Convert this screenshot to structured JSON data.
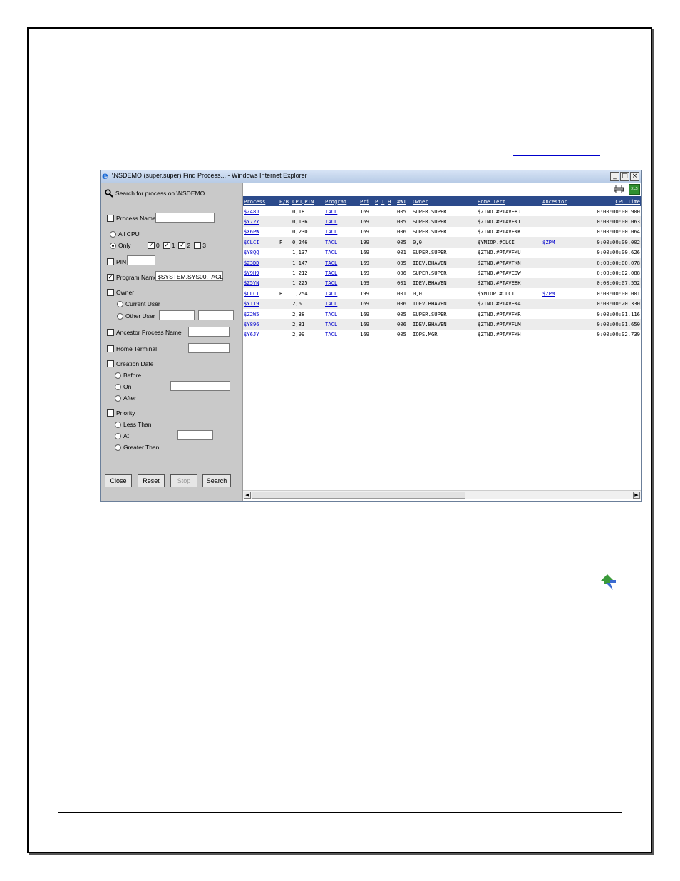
{
  "window": {
    "title": "\\NSDEMO (super.super) Find Process... - Windows Internet Explorer",
    "minimize": "_",
    "maximize": "□",
    "close": "×"
  },
  "search_panel": {
    "heading": "Search for process on \\NSDEMO",
    "process_name": {
      "label": "Process Name",
      "checked": false,
      "value": ""
    },
    "cpu": {
      "all_label": "All CPU",
      "only_label": "Only",
      "selected": "Only",
      "cpus": [
        {
          "label": "0",
          "checked": true
        },
        {
          "label": "1",
          "checked": true
        },
        {
          "label": "2",
          "checked": true
        },
        {
          "label": "3",
          "checked": false
        }
      ]
    },
    "pin": {
      "label": "PIN",
      "checked": false,
      "value": ""
    },
    "program_name": {
      "label": "Program Name",
      "checked": true,
      "value": "$SYSTEM.SYS00.TACL"
    },
    "owner": {
      "label": "Owner",
      "checked": false,
      "current_user_label": "Current User",
      "other_user_label": "Other User"
    },
    "ancestor": {
      "label": "Ancestor Process Name",
      "checked": false,
      "value": ""
    },
    "home_terminal": {
      "label": "Home Terminal",
      "checked": false,
      "value": ""
    },
    "creation_date": {
      "label": "Creation Date",
      "checked": false,
      "before_label": "Before",
      "on_label": "On",
      "after_label": "After",
      "value": ""
    },
    "priority": {
      "label": "Priority",
      "checked": false,
      "less_label": "Less Than",
      "at_label": "At",
      "greater_label": "Greater Than",
      "value": ""
    },
    "buttons": {
      "close": "Close",
      "reset": "Reset",
      "stop": "Stop",
      "search": "Search"
    }
  },
  "results": {
    "columns": [
      "Process",
      "P/B",
      "CPU,PIN",
      "Program",
      "Pri",
      "P",
      "I",
      "H",
      "#WI",
      "Owner",
      "Home Term",
      "Ancestor",
      "CPU Time"
    ],
    "rows": [
      [
        "$Z48J",
        "",
        "0,18",
        "TACL",
        "169",
        "",
        "",
        "",
        "005",
        "SUPER.SUPER",
        "$ZTNO.#PTAVE8J",
        "",
        "0:00:00:00.900"
      ],
      [
        "$Y72Y",
        "",
        "0,136",
        "TACL",
        "169",
        "",
        "",
        "",
        "005",
        "SUPER.SUPER",
        "$ZTNO.#PTAVFKT",
        "",
        "0:00:00:00.063"
      ],
      [
        "$X6PW",
        "",
        "0,230",
        "TACL",
        "169",
        "",
        "",
        "",
        "006",
        "SUPER.SUPER",
        "$ZTNO.#PTAVFKK",
        "",
        "0:00:00:00.064"
      ],
      [
        "$CLCI",
        "P",
        "0,246",
        "TACL",
        "199",
        "",
        "",
        "",
        "005",
        "0,0",
        "$YMIOP.#CLCI",
        "$ZPM",
        "0:00:00:00.002"
      ],
      [
        "$Y8QQ",
        "",
        "1,137",
        "TACL",
        "169",
        "",
        "",
        "",
        "001",
        "SUPER.SUPER",
        "$ZTNO.#PTAVFKU",
        "",
        "0:00:00:00.626"
      ],
      [
        "$Z3DD",
        "",
        "1,147",
        "TACL",
        "169",
        "",
        "",
        "",
        "005",
        "IDEV.BHAVEN",
        "$ZTNO.#PTAVFKN",
        "",
        "0:00:00:00.078"
      ],
      [
        "$Y9H9",
        "",
        "1,212",
        "TACL",
        "169",
        "",
        "",
        "",
        "006",
        "SUPER.SUPER",
        "$ZTNO.#PTAVE9W",
        "",
        "0:00:00:02.088"
      ],
      [
        "$Z5YN",
        "",
        "1,225",
        "TACL",
        "169",
        "",
        "",
        "",
        "001",
        "IDEV.BHAVEN",
        "$ZTNO.#PTAVE8K",
        "",
        "0:00:00:07.552"
      ],
      [
        "$CLCI",
        "B",
        "1,254",
        "TACL",
        "199",
        "",
        "",
        "",
        "001",
        "0,0",
        "$YMIOP.#CLCI",
        "$ZPM",
        "0:00:00:00.001"
      ],
      [
        "$Y119",
        "",
        "2,6",
        "TACL",
        "169",
        "",
        "",
        "",
        "006",
        "IDEV.BHAVEN",
        "$ZTNO.#PTAVEK4",
        "",
        "0:00:00:20.330"
      ],
      [
        "$Z2W5",
        "",
        "2,38",
        "TACL",
        "169",
        "",
        "",
        "",
        "005",
        "SUPER.SUPER",
        "$ZTNO.#PTAVFKR",
        "",
        "0:00:00:01.116"
      ],
      [
        "$Y896",
        "",
        "2,81",
        "TACL",
        "169",
        "",
        "",
        "",
        "006",
        "IDEV.BHAVEN",
        "$ZTNO.#PTAVFLM",
        "",
        "0:00:00:01.650"
      ],
      [
        "$Y6JY",
        "",
        "2,99",
        "TACL",
        "169",
        "",
        "",
        "",
        "005",
        "IOPS.MGR",
        "$ZTNO.#PTAVFKH",
        "",
        "0:00:00:02.739"
      ]
    ]
  },
  "colors": {
    "header_bg": "#2b4a8b",
    "panel_bg": "#c9c9c9",
    "link": "#0000cc",
    "excel_icon": "#2f8f2f"
  }
}
